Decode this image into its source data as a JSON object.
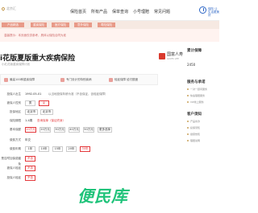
{
  "header": {
    "location": "北京汇",
    "nav": [
      "保险首页",
      "所有产品",
      "保单查询",
      "小号理赔",
      "常见问题"
    ],
    "slogan": "保险 让生活更美好"
  },
  "categories": [
    "产品精选",
    "重疾保险",
    "医疗保险",
    "意外保险",
    "寿险保险"
  ],
  "notice": "温馨提示：本页面仅供参考，具体以保险合同为准",
  "product": {
    "title": "i花版夏版重大疾病保险",
    "subtitle": "小红花版重疾保障计划",
    "brand": "国富人寿",
    "brand_sub": "GUOFU LIFE"
  },
  "tags": [
    "最高100种重疾保障",
    "专门设计的特别疾病",
    "轻症保障 给付额度"
  ],
  "form": {
    "rows": [
      {
        "label": "投保人出生",
        "value": "1992-05-01"
      },
      {
        "label": "被保人性别",
        "options": [
          "男",
          "女"
        ],
        "selected": 1
      },
      {
        "label": "投保地区",
        "value": "北京市",
        "extra": "北京市"
      },
      {
        "label": "保险期限",
        "value": "1-4周"
      },
      {
        "label": "基本保额",
        "options": [
          "10万元",
          "20万元",
          "30万元",
          "40万元",
          "50万元"
        ],
        "selected": 0,
        "extra": "更多选择"
      },
      {
        "label": "缴费方式",
        "value": "年交"
      },
      {
        "label": "缴费年期",
        "options": [
          "1年",
          "10年",
          "15年",
          "20年",
          "30年"
        ],
        "selected": 4
      },
      {
        "label": "是否附加保费豁免",
        "options": [
          "不含"
        ],
        "selected": 0
      },
      {
        "label": "被保人轻症",
        "options": [
          "不含"
        ],
        "selected": 0
      },
      {
        "label": "投保人轻症",
        "options": [
          "不含"
        ],
        "selected": 0
      }
    ],
    "hint_label": "保险期限",
    "hint_value": "1-4周",
    "hint_extra": "查询保单（保证终身）",
    "age_note": "以当地投保年龄为准（不含保证，含轻症保障）"
  },
  "sidebar": {
    "price_title": "累计保障",
    "price_value": "2450",
    "service_title": "服务与承诺",
    "service_items": [
      "一对一顾问服务",
      "快速理赔服务",
      "VIP线上服务"
    ],
    "customer_title": "客户须知",
    "customer_items": [
      "产品条款",
      "投保须知",
      "健康告知",
      "理赔说明"
    ]
  },
  "watermark": "便民库",
  "colors": {
    "accent": "#e4393c",
    "brand": "#2a64c5",
    "watermark": "#1fc37a"
  }
}
